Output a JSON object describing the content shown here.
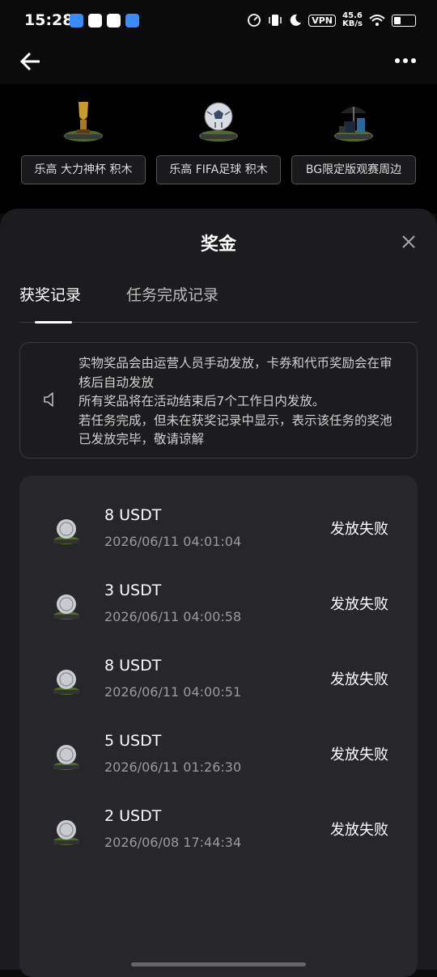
{
  "status_bar": {
    "time": "15:28",
    "vpn": "VPN",
    "speed_value": "45.6",
    "speed_unit": "KB/s"
  },
  "topbar": {
    "back_icon": "arrow-left-icon",
    "more_icon": "more-dots-icon"
  },
  "prizes": [
    {
      "label": "乐高 大力神杯 积木",
      "icon": "trophy-block-icon"
    },
    {
      "label": "乐高 FIFA足球 积木",
      "icon": "football-block-icon"
    },
    {
      "label": "BG限定版观赛周边",
      "icon": "merch-bundle-icon"
    }
  ],
  "sheet": {
    "title": "奖金",
    "close_icon": "close-icon",
    "tabs": [
      "获奖记录",
      "任务完成记录"
    ],
    "notice": {
      "icon": "speaker-icon",
      "lines": [
        "实物奖品会由运营人员手动发放，卡券和代币奖励会在审核后自动发放",
        "所有奖品将在活动结束后7个工作日内发放。",
        "若任务完成，但未在获奖记录中显示，表示该任务的奖池已发放完毕，敬请谅解"
      ]
    },
    "records": [
      {
        "amount": "8 USDT",
        "date": "2026/06/11 04:01:04",
        "status": "发放失败"
      },
      {
        "amount": "3 USDT",
        "date": "2026/06/11 04:00:58",
        "status": "发放失败"
      },
      {
        "amount": "8 USDT",
        "date": "2026/06/11 04:00:51",
        "status": "发放失败"
      },
      {
        "amount": "5 USDT",
        "date": "2026/06/11 01:26:30",
        "status": "发放失败"
      },
      {
        "amount": "2 USDT",
        "date": "2026/06/08 17:44:34",
        "status": "发放失败"
      }
    ]
  }
}
